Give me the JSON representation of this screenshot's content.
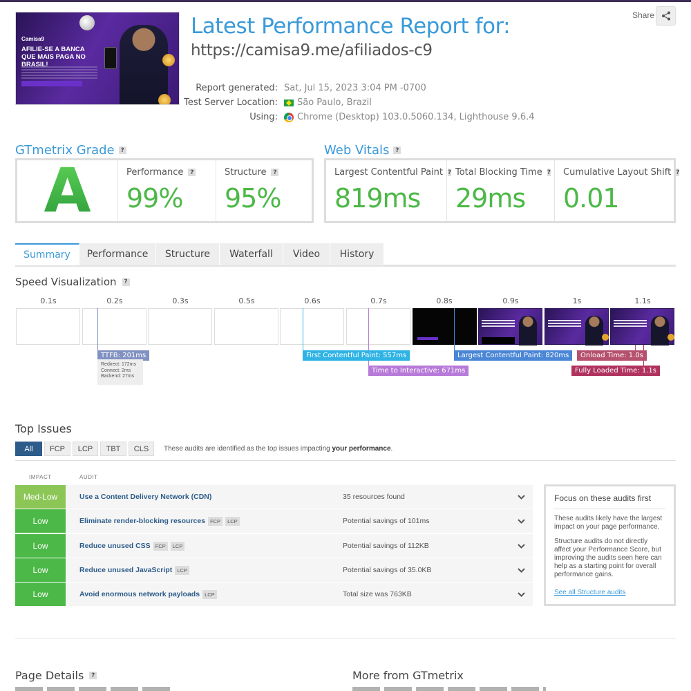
{
  "header": {
    "title": "Latest Performance Report for:",
    "url": "https://camisa9.me/afiliados-c9",
    "share_label": "Share",
    "share_icon": "share-icon"
  },
  "thumbnail": {
    "brand": "Camisa9",
    "headline": "AFILIE-SE A BANCA QUE MAIS PAGA NO BRASIL!"
  },
  "meta": {
    "report_generated_label": "Report generated:",
    "report_generated_value": "Sat, Jul 15, 2023 3:04 PM -0700",
    "server_label": "Test Server Location:",
    "server_value": "São Paulo, Brazil",
    "using_label": "Using:",
    "using_value": "Chrome (Desktop) 103.0.5060.134, Lighthouse 9.6.4"
  },
  "grade": {
    "heading": "GTmetrix Grade",
    "letter": "A",
    "performance_label": "Performance",
    "performance_value": "99%",
    "structure_label": "Structure",
    "structure_value": "95%"
  },
  "vitals": {
    "heading": "Web Vitals",
    "lcp_label": "Largest Contentful Paint",
    "lcp_value": "819ms",
    "tbt_label": "Total Blocking Time",
    "tbt_value": "29ms",
    "cls_label": "Cumulative Layout Shift",
    "cls_value": "0.01"
  },
  "tabs": [
    "Summary",
    "Performance",
    "Structure",
    "Waterfall",
    "Video",
    "History"
  ],
  "speed": {
    "heading": "Speed Visualization",
    "ticks": [
      "0.1s",
      "0.2s",
      "0.3s",
      "0.5s",
      "0.6s",
      "0.7s",
      "0.8s",
      "0.9s",
      "1s",
      "1.1s"
    ],
    "ttfb": "TTFB: 201ms",
    "ttfb_redirect": "Redirect: 172ms",
    "ttfb_connect": "Connect: 2ms",
    "ttfb_backend": "Backend: 27ms",
    "fcp": "First Contentful Paint: 557ms",
    "tti": "Time to Interactive: 671ms",
    "lcp": "Largest Contentful Paint: 820ms",
    "onload": "Onload Time: 1.0s",
    "fully_loaded": "Fully Loaded Time: 1.1s"
  },
  "top_issues": {
    "heading": "Top Issues",
    "filters": [
      "All",
      "FCP",
      "LCP",
      "TBT",
      "CLS"
    ],
    "note_prefix": "These audits are identified as the top issues impacting",
    "note_bold": "your performance",
    "note_suffix": ".",
    "col_impact": "IMPACT",
    "col_audit": "AUDIT",
    "rows": [
      {
        "impact": "Med-Low",
        "audit": "Use a Content Delivery Network (CDN)",
        "tag1": "",
        "tag2": "",
        "result": "35 resources found"
      },
      {
        "impact": "Low",
        "audit": "Eliminate render-blocking resources",
        "tag1": "FCP",
        "tag2": "LCP",
        "result": "Potential savings of 101ms"
      },
      {
        "impact": "Low",
        "audit": "Reduce unused CSS",
        "tag1": "FCP",
        "tag2": "LCP",
        "result": "Potential savings of 112KB"
      },
      {
        "impact": "Low",
        "audit": "Reduce unused JavaScript",
        "tag1": "LCP",
        "tag2": "",
        "result": "Potential savings of 35.0KB"
      },
      {
        "impact": "Low",
        "audit": "Avoid enormous network payloads",
        "tag1": "LCP",
        "tag2": "",
        "result": "Total size was 763KB"
      }
    ],
    "impact_colors": {
      "Med-Low": "#8cc657",
      "Low": "#4cb847"
    }
  },
  "focus": {
    "heading": "Focus on these audits first",
    "p1": "These audits likely have the largest impact on your page performance.",
    "p2": "Structure audits do not directly affect your Performance Score, but improving the audits seen here can help as a starting point for overall performance gains.",
    "link": "See all Structure audits"
  },
  "bottom": {
    "page_details": "Page Details",
    "more_from": "More from GTmetrix"
  },
  "colors": {
    "accent": "#3a9ad9",
    "grade_green": "#4cb847",
    "ttfb": "#8191c2",
    "fcp": "#2fb3e5",
    "tti": "#b77ad9",
    "lcp": "#4a86d6",
    "onload": "#b5506e",
    "fully_loaded": "#b0325e"
  }
}
